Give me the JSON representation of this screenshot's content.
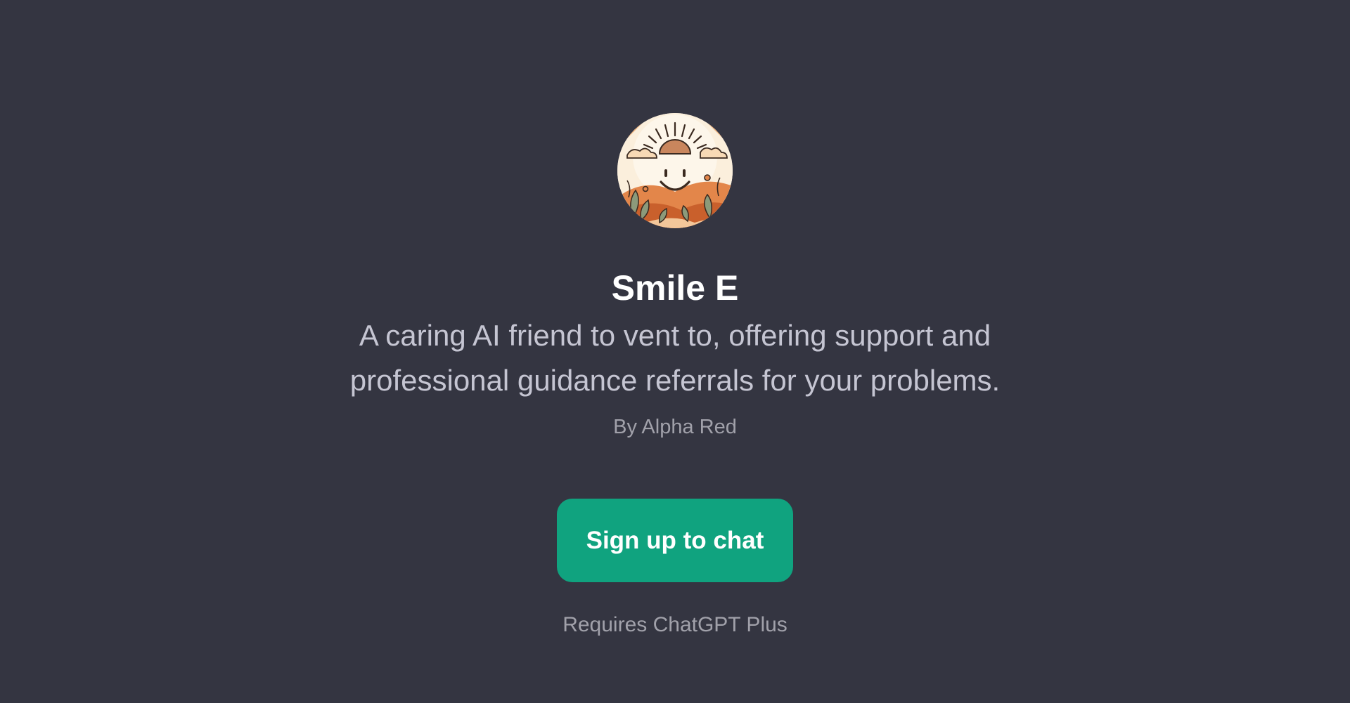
{
  "gpt": {
    "name": "Smile E",
    "description": "A caring AI friend to vent to, offering support and professional guidance referrals for your problems.",
    "author": "By Alpha Red",
    "avatar_icon": "smiling-sun-icon"
  },
  "actions": {
    "signup_label": "Sign up to chat",
    "requirement": "Requires ChatGPT Plus"
  },
  "colors": {
    "background": "#343541",
    "accent": "#10a37f",
    "title": "#ffffff",
    "body_text": "#c5c5d2",
    "muted_text": "#a1a1aa"
  }
}
